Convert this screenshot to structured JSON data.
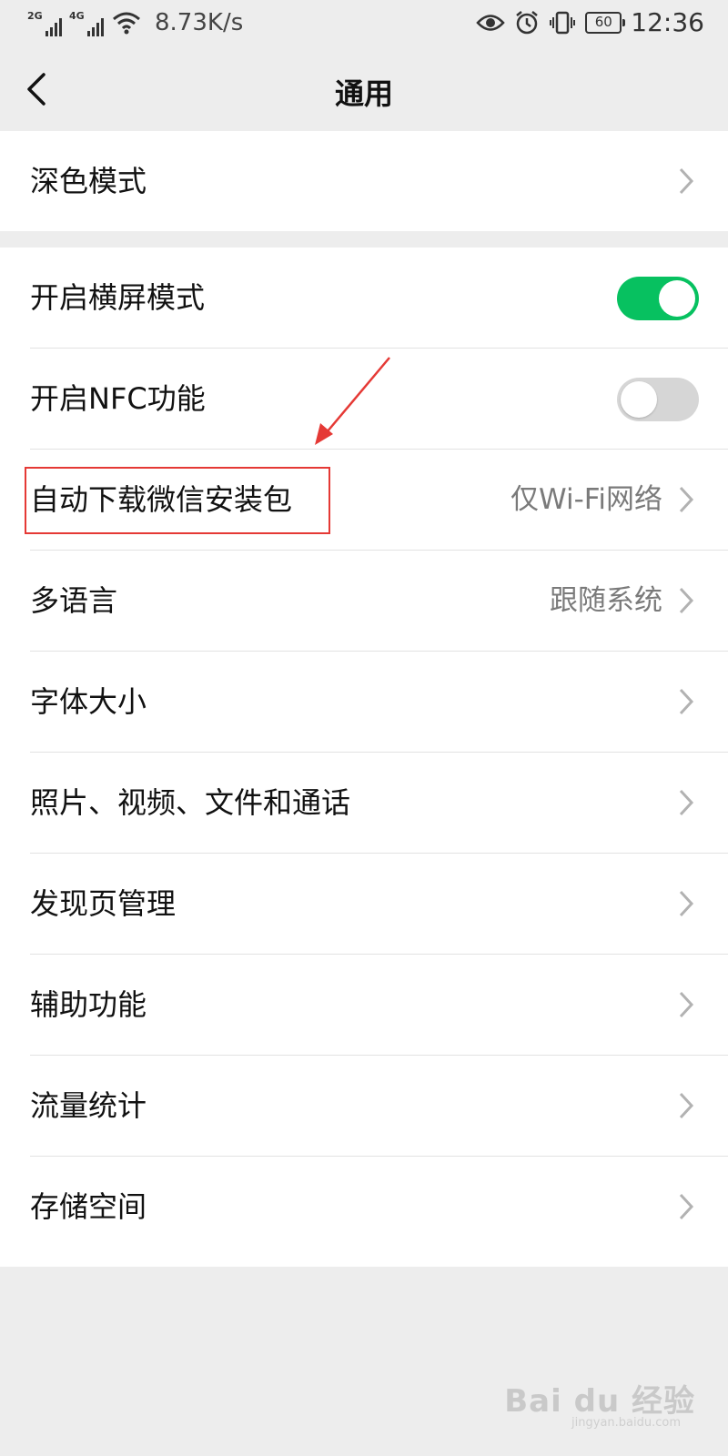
{
  "status_bar": {
    "signal1_label": "2G",
    "signal2_label": "4G",
    "speed": "8.73K/s",
    "battery": "60",
    "time": "12:36"
  },
  "header": {
    "title": "通用"
  },
  "section1": {
    "items": [
      {
        "label": "深色模式"
      }
    ]
  },
  "section2": {
    "items": [
      {
        "label": "开启横屏模式",
        "toggle": true
      },
      {
        "label": "开启NFC功能",
        "toggle": false
      },
      {
        "label": "自动下载微信安装包",
        "value": "仅Wi-Fi网络"
      },
      {
        "label": "多语言",
        "value": "跟随系统"
      },
      {
        "label": "字体大小"
      },
      {
        "label": "照片、视频、文件和通话"
      },
      {
        "label": "发现页管理"
      },
      {
        "label": "辅助功能"
      },
      {
        "label": "流量统计"
      },
      {
        "label": "存储空间"
      }
    ]
  },
  "watermark": {
    "brand": "Bai du 经验",
    "url": "jingyan.baidu.com"
  },
  "colors": {
    "toggle_on": "#07c160",
    "annotation": "#e53935"
  }
}
